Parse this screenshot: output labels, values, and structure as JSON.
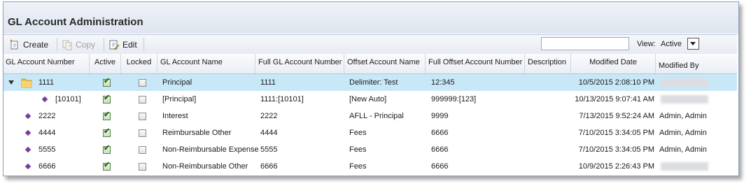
{
  "title": "GL Account Administration",
  "toolbar": {
    "create_label": "Create",
    "copy_label": "Copy",
    "edit_label": "Edit",
    "search_value": "",
    "view_label": "View:",
    "view_value": "Active"
  },
  "columns": {
    "gl_account_number": "GL Account Number",
    "active": "Active",
    "locked": "Locked",
    "gl_account_name": "GL Account Name",
    "full_gl_account_number": "Full GL Account Number",
    "offset_account_name": "Offset Account Name",
    "full_offset_account_number": "Full Offset Account Number",
    "description": "Description",
    "modified_date": "Modified Date",
    "modified_by": "Modified By"
  },
  "rows": [
    {
      "number": "1111",
      "active": true,
      "locked": false,
      "name": "Principal",
      "full_number": "1111",
      "offset_name": "Delimiter: Test",
      "offset_number": "12:345",
      "description": "",
      "modified_date": "10/5/2015 2:08:10 PM",
      "modified_by": ""
    },
    {
      "number": "[10101]",
      "active": true,
      "locked": false,
      "name": "[Principal]",
      "full_number": "1111:[10101]",
      "offset_name": "[New Auto]",
      "offset_number": "999999:[123]",
      "description": "",
      "modified_date": "10/13/2015 9:07:41 AM",
      "modified_by": ""
    },
    {
      "number": "2222",
      "active": true,
      "locked": false,
      "name": "Interest",
      "full_number": "2222",
      "offset_name": "AFLL - Principal",
      "offset_number": "9999",
      "description": "",
      "modified_date": "7/13/2015 9:52:24 AM",
      "modified_by": "Admin, Admin"
    },
    {
      "number": "4444",
      "active": true,
      "locked": false,
      "name": "Reimbursable Other",
      "full_number": "4444",
      "offset_name": "Fees",
      "offset_number": "6666",
      "description": "",
      "modified_date": "7/10/2015 3:34:05 PM",
      "modified_by": "Admin, Admin"
    },
    {
      "number": "5555",
      "active": true,
      "locked": false,
      "name": "Non-Reimbursable Expense",
      "full_number": "5555",
      "offset_name": "Fees",
      "offset_number": "6666",
      "description": "",
      "modified_date": "7/10/2015 3:34:05 PM",
      "modified_by": "Admin, Admin"
    },
    {
      "number": "6666",
      "active": true,
      "locked": false,
      "name": "Non-Reimbursable Other",
      "full_number": "6666",
      "offset_name": "Fees",
      "offset_number": "6666",
      "description": "",
      "modified_date": "10/9/2015 2:26:43 PM",
      "modified_by": ""
    }
  ]
}
